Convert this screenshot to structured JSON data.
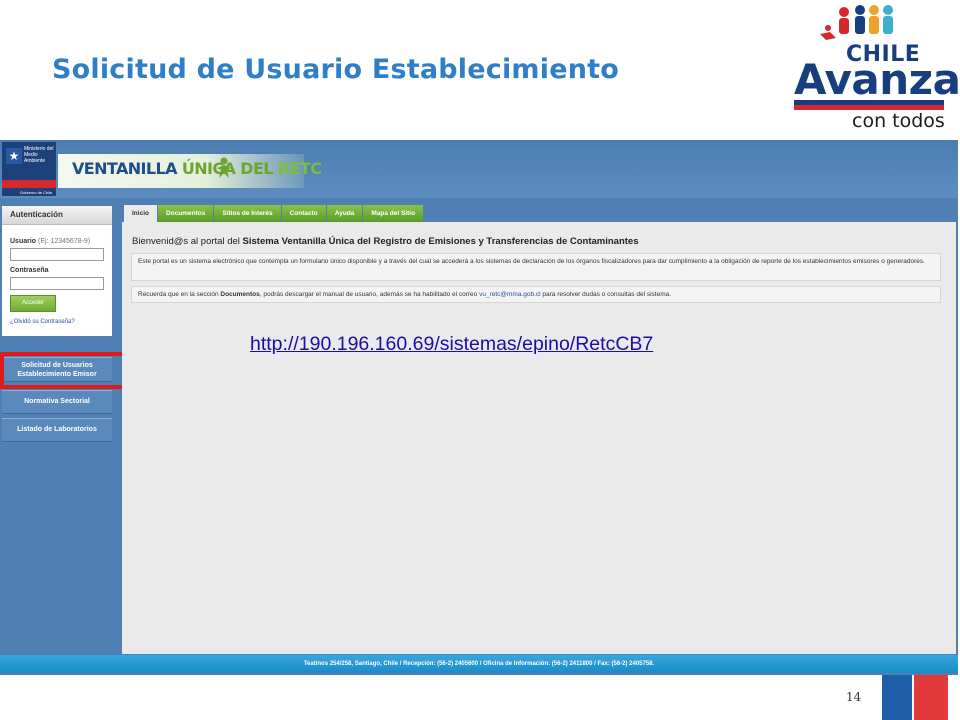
{
  "slide": {
    "title": "Solicitud de Usuario Establecimiento",
    "number": "14"
  },
  "logo": {
    "line1": "CHILE",
    "line2": "Avanza",
    "line3": "con todos"
  },
  "portal": {
    "gov_logo_text": "Ministerio del Medio Ambiente",
    "gov_logo_bottom": "Gobierno de Chile",
    "banner_part1": "VENTANILLA ",
    "banner_part2": "ÚNICA DEL",
    "banner_part3": " RETC",
    "login": {
      "header": "Autenticación",
      "user_label": "Usuario",
      "user_hint": "(Ej: 12345678-9)",
      "password_label": "Contraseña",
      "button": "Acceder",
      "forgot": "¿Olvidó su Contraseña?"
    },
    "side_menu": {
      "solicitud_line1": "Solicitud de Usuarios",
      "solicitud_line2": "Establecimiento Emisor",
      "normativa": "Normativa Sectorial",
      "listado": "Listado de Laboratorios"
    },
    "tabs": [
      "Inicio",
      "Documentos",
      "Sitios de Interés",
      "Contacto",
      "Ayuda",
      "Mapa del Sitio"
    ],
    "welcome_prefix": "Bienvenid@s al portal del ",
    "welcome_bold": "Sistema Ventanilla Única del Registro de Emisiones y Transferencias de Contaminantes",
    "info1": "Este portal es un sistema electrónico que contempla un formulario único disponible y a través del cual se accederá a los sistemas de declaración de los órganos fiscalizadores para dar cumplimiento a la obligación de reporte de los establecimientos emisores o generadores.",
    "info2_prefix": "Recuerda que en la sección ",
    "info2_bold": "Documentos",
    "info2_mid": ", podrás descargar el manual de usuario, además se ha habilitado el correo ",
    "info2_email": "vu_retc@mma.gob.cl",
    "info2_suffix": " para resolver dudas o consultas del sistema.",
    "footer": "Teatinos 254/258, Santiago, Chile / Recepción: (56-2) 2405600 / Oficina de Información: (56-2) 2411800 / Fax: (56-2) 2405758."
  },
  "url": "http://190.196.160.69/sistemas/epino/RetcCB7",
  "colors": {
    "title_blue": "#2e7fc7",
    "tab_green": "#6fac2f",
    "highlight_red": "#e01b1b",
    "link_blue": "#1a0dab"
  }
}
